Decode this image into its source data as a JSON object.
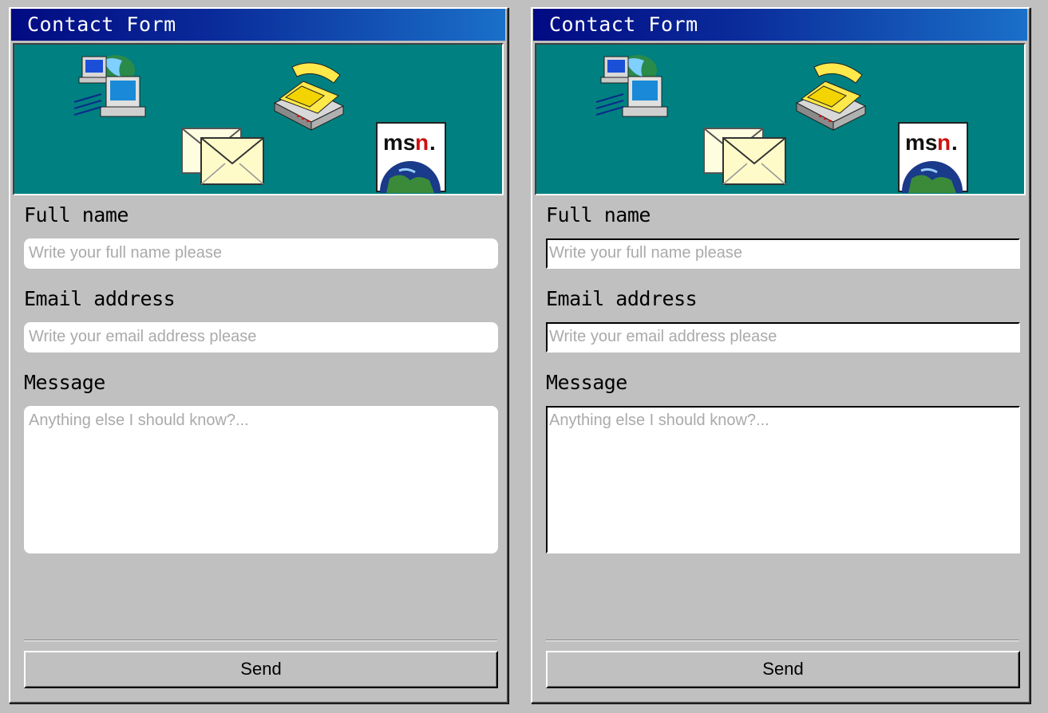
{
  "forms": [
    {
      "title": "Contact Form",
      "fields": {
        "full_name": {
          "label": "Full name",
          "placeholder": "Write your full name please",
          "value": ""
        },
        "email": {
          "label": "Email address",
          "placeholder": "Write your email address please",
          "value": ""
        },
        "message": {
          "label": "Message",
          "placeholder": "Anything else I should know?...",
          "value": ""
        }
      },
      "send_label": "Send",
      "banner_icons": [
        "network-computer-icon",
        "telephone-icon",
        "envelopes-icon",
        "msn-globe-icon"
      ],
      "msn_text": "msn."
    },
    {
      "title": "Contact Form",
      "fields": {
        "full_name": {
          "label": "Full name",
          "placeholder": "Write your full name please",
          "value": ""
        },
        "email": {
          "label": "Email address",
          "placeholder": "Write your email address please",
          "value": ""
        },
        "message": {
          "label": "Message",
          "placeholder": "Anything else I should know?...",
          "value": ""
        }
      },
      "send_label": "Send",
      "banner_icons": [
        "network-computer-icon",
        "telephone-icon",
        "envelopes-icon",
        "msn-globe-icon"
      ],
      "msn_text": "msn."
    }
  ],
  "colors": {
    "desktop": "#c0c0c0",
    "banner": "#008080",
    "title_start": "#020a82",
    "title_end": "#1a70c8",
    "placeholder": "#aaaaaa"
  }
}
